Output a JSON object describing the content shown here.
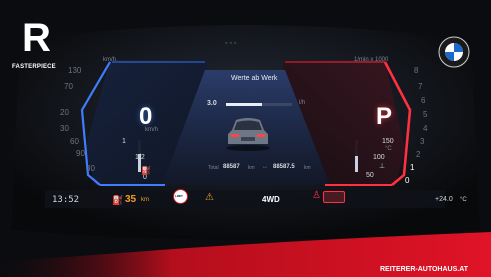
{
  "brand": {
    "logo_letter": "R",
    "logo_caption": "FASTERPIECE",
    "dealer_banner": "REITERER-AUTOHAUS.AT"
  },
  "left_gauge": {
    "unit": "km/h",
    "speed_value": "0",
    "speed_unit": "km/h",
    "ticks": [
      "130",
      "70",
      "20",
      "30",
      "60",
      "90",
      "30"
    ],
    "fuel_labels": [
      "1",
      "1/2",
      "0"
    ],
    "fuel_level": 0.55
  },
  "right_gauge": {
    "unit": "1/min x 1000",
    "gear": "P",
    "ticks": [
      "8",
      "7",
      "6",
      "5",
      "4",
      "3",
      "2",
      "1",
      "0"
    ],
    "temp_labels": [
      "150",
      "°C",
      "100",
      "50"
    ],
    "temp_level": 0.5
  },
  "center": {
    "title": "Werte ab Werk",
    "consumption_value": "3.0",
    "consumption_unit": "l/h",
    "consumption_level": 0.55,
    "odo_label": "Total",
    "odo_value": "88587",
    "odo_unit": "km",
    "trip_value": "88587.5",
    "trip_unit": "km"
  },
  "bottom_bar": {
    "time": "13:52",
    "range_value": "35",
    "range_unit": "km",
    "limit_sign": "LIMIT",
    "drive_mode": "4WD",
    "outside_temp": "+24.0",
    "outside_temp_unit": "°C"
  },
  "colors": {
    "accent_blue": "#3f7dff",
    "accent_red": "#ff3040",
    "warning_amber": "#f0a020"
  }
}
